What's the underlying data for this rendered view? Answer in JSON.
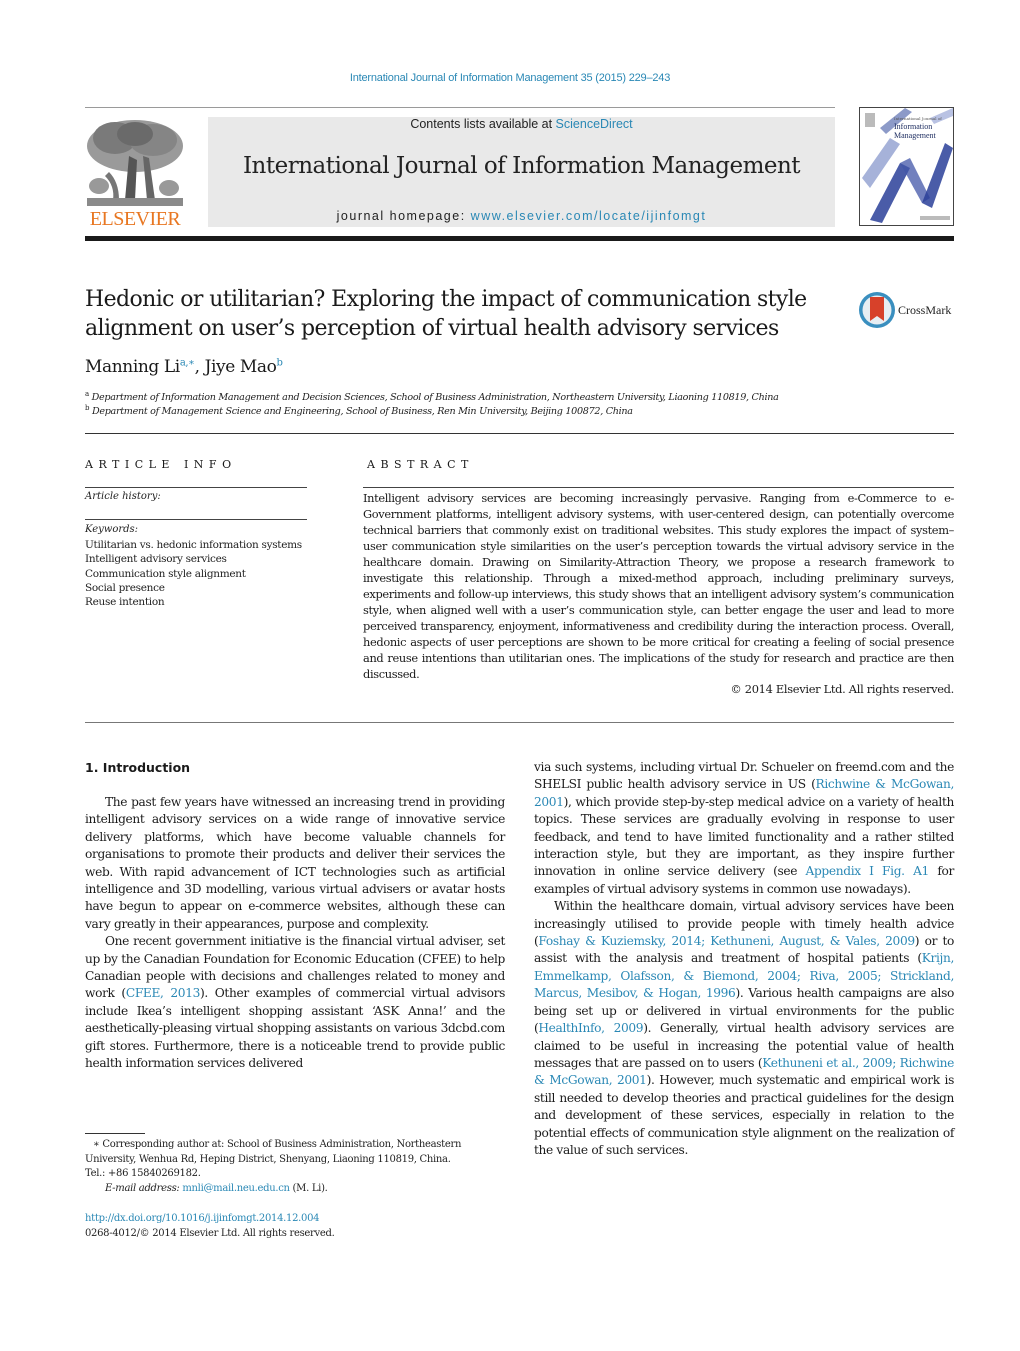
{
  "header": {
    "journal_reference": "International Journal of Information Management 35 (2015) 229–243",
    "contents_prefix": "Contents lists available at ",
    "contents_link": "ScienceDirect",
    "journal_title": "International Journal of Information Management",
    "homepage_prefix": "journal homepage: ",
    "homepage_link": "www.elsevier.com/locate/ijinfomgt",
    "publisher_logo_text": "ELSEVIER",
    "cover": {
      "small_line": "International Journal of",
      "title_line1": "Information",
      "title_line2": "Management"
    },
    "colors": {
      "link": "#2a88b5",
      "elsevier_orange": "#e87722",
      "masthead_bg": "#e9e9e9"
    }
  },
  "article": {
    "title": "Hedonic or utilitarian? Exploring the impact of communication style alignment on user’s perception of virtual health advisory services",
    "crossmark_label": "CrossMark",
    "authors": [
      {
        "name": "Manning Li",
        "sup": "a,∗"
      },
      {
        "name": "Jiye Mao",
        "sup": "b"
      }
    ],
    "affiliations": [
      {
        "mark": "a",
        "text": "Department of Information Management and Decision Sciences, School of Business Administration, Northeastern University, Liaoning 110819, China"
      },
      {
        "mark": "b",
        "text": "Department of Management Science and Engineering, School of Business, Ren Min University, Beijing 100872, China"
      }
    ]
  },
  "article_info": {
    "heading": "ARTICLE INFO",
    "history_label": "Article history:",
    "keywords_label": "Keywords:",
    "keywords": [
      "Utilitarian vs. hedonic information systems",
      "Intelligent advisory services",
      "Communication style alignment",
      "Social presence",
      "Reuse intention"
    ]
  },
  "abstract": {
    "heading": "ABSTRACT",
    "text": "Intelligent advisory services are becoming increasingly pervasive. Ranging from e-Commerce to e-Government platforms, intelligent advisory systems, with user-centered design, can potentially overcome technical barriers that commonly exist on traditional websites. This study explores the impact of system–user communication style similarities on the user’s perception towards the virtual advisory service in the healthcare domain. Drawing on Similarity-Attraction Theory, we propose a research framework to investigate this relationship. Through a mixed-method approach, including preliminary surveys, experiments and follow-up interviews, this study shows that an intelligent advisory system’s communication style, when aligned well with a user’s communication style, can better engage the user and lead to more perceived transparency, enjoyment, informativeness and credibility during the interaction process. Overall, hedonic aspects of user perceptions are shown to be more critical for creating a feeling of social presence and reuse intentions than utilitarian ones. The implications of the study for research and practice are then discussed.",
    "copyright": "© 2014 Elsevier Ltd. All rights reserved."
  },
  "body": {
    "section_heading": "1.  Introduction",
    "left": {
      "p1": "The past few years have witnessed an increasing trend in providing intelligent advisory services on a wide range of innovative service delivery platforms, which have become valuable channels for organisations to promote their products and deliver their services the web. With rapid advancement of ICT technologies such as artificial intelligence and 3D modelling, various virtual advisers or avatar hosts have begun to appear on e-commerce websites, although these can vary greatly in their appearances, purpose and complexity.",
      "p2_a": "One recent government initiative is the financial virtual adviser, set up by the Canadian Foundation for Economic Education (CFEE) to help Canadian people with decisions and challenges related to money and work (",
      "p2_cite": "CFEE, 2013",
      "p2_b": "). Other examples of commercial virtual advisors include Ikea’s intelligent shopping assistant ‘ASK Anna!’ and the aesthetically-pleasing virtual shopping assistants on various 3dcbd.com gift stores. Furthermore, there is a noticeable trend to provide public health information services delivered"
    },
    "right": {
      "p1_a": "via such systems, including virtual Dr. Schueler on freemd.com and the SHELSI public health advisory service in US (",
      "p1_cite1": "Richwine & McGowan, 2001",
      "p1_b": "), which provide step-by-step medical advice on a variety of health topics. These services are gradually evolving in response to user feedback, and tend to have limited functionality and a rather stilted interaction style, but they are important, as they inspire further innovation in online service delivery (see ",
      "p1_cite2": "Appendix I Fig. A1",
      "p1_c": " for examples of virtual advisory systems in common use nowadays).",
      "p2_a": "Within the healthcare domain, virtual advisory services have been increasingly utilised to provide people with timely health advice (",
      "p2_cite1": "Foshay & Kuziemsky, 2014; Kethuneni, August, & Vales, 2009",
      "p2_b": ") or to assist with the analysis and treatment of hospital patients (",
      "p2_cite2": "Krijn, Emmelkamp, Olafsson, & Biemond, 2004; Riva, 2005; Strickland, Marcus, Mesibov, & Hogan, 1996",
      "p2_c": "). Various health campaigns are also being set up or delivered in virtual environments for the public (",
      "p2_cite3": "HealthInfo, 2009",
      "p2_d": "). Generally, virtual health advisory services are claimed to be useful in increasing the potential value of health messages that are passed on to users (",
      "p2_cite4": "Kethuneni et al., 2009; Richwine & McGowan, 2001",
      "p2_e": "). However, much systematic and empirical work is still needed to develop theories and practical guidelines for the design and development of these services, especially in relation to the potential effects of communication style alignment on the realization of the value of such services."
    }
  },
  "footnote": {
    "star_text": "∗  Corresponding author at: School of Business Administration, Northeastern University, Wenhua Rd, Heping District, Shenyang, Liaoning 110819, China.",
    "tel": "Tel.: +86 15840269182.",
    "email_label": "E-mail address: ",
    "email": "mnli@mail.neu.edu.cn",
    "email_suffix": " (M. Li).",
    "doi_link": "http://dx.doi.org/10.1016/j.ijinfomgt.2014.12.004",
    "issn_line": "0268-4012/© 2014 Elsevier Ltd. All rights reserved."
  }
}
